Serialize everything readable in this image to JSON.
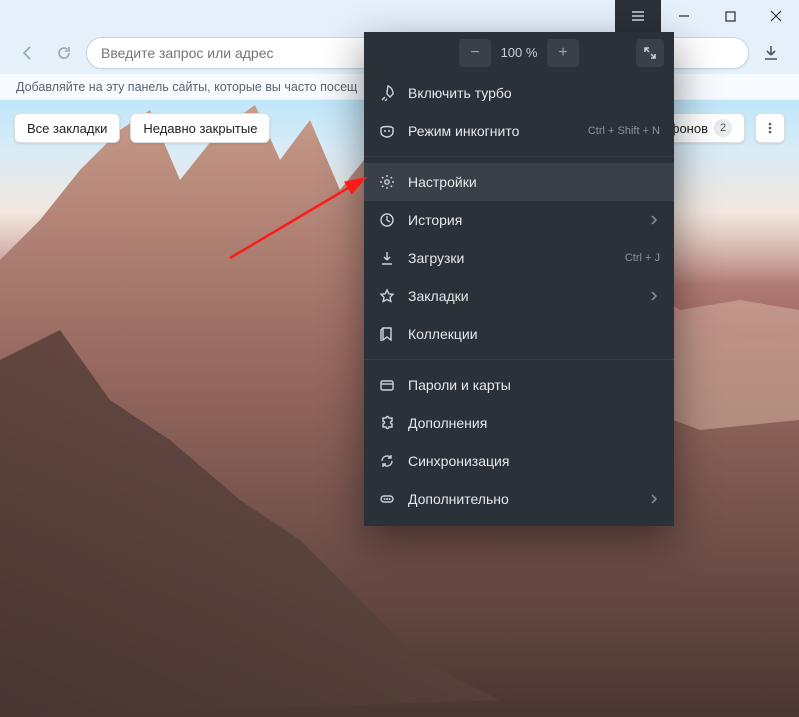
{
  "titlebar": {
    "menu_active": true
  },
  "toolbar": {
    "address_placeholder": "Введите запрос или адрес"
  },
  "hintbar": {
    "text": "Добавляйте на эту панель сайты, которые вы часто посещ"
  },
  "chips": {
    "all_bookmarks": "Все закладки",
    "recently_closed": "Недавно закрытые",
    "gallery_partial": "я фонов",
    "gallery_badge": "2"
  },
  "menu": {
    "zoom": {
      "minus": "−",
      "value": "100 %",
      "plus": "+"
    },
    "items": [
      {
        "icon": "rocket",
        "label": "Включить турбо",
        "hint": "",
        "chevron": false,
        "hover": false
      },
      {
        "icon": "mask",
        "label": "Режим инкогнито",
        "hint": "Ctrl + Shift + N",
        "chevron": false,
        "hover": false
      },
      {
        "sep": true
      },
      {
        "icon": "gear",
        "label": "Настройки",
        "hint": "",
        "chevron": false,
        "hover": true
      },
      {
        "icon": "clock",
        "label": "История",
        "hint": "",
        "chevron": true,
        "hover": false
      },
      {
        "icon": "download",
        "label": "Загрузки",
        "hint": "Ctrl + J",
        "chevron": false,
        "hover": false
      },
      {
        "icon": "star",
        "label": "Закладки",
        "hint": "",
        "chevron": true,
        "hover": false
      },
      {
        "icon": "collection",
        "label": "Коллекции",
        "hint": "",
        "chevron": false,
        "hover": false
      },
      {
        "sep": true
      },
      {
        "icon": "card",
        "label": "Пароли и карты",
        "hint": "",
        "chevron": false,
        "hover": false
      },
      {
        "icon": "puzzle",
        "label": "Дополнения",
        "hint": "",
        "chevron": false,
        "hover": false
      },
      {
        "icon": "sync",
        "label": "Синхронизация",
        "hint": "",
        "chevron": false,
        "hover": false
      },
      {
        "icon": "dots",
        "label": "Дополнительно",
        "hint": "",
        "chevron": true,
        "hover": false
      }
    ]
  }
}
